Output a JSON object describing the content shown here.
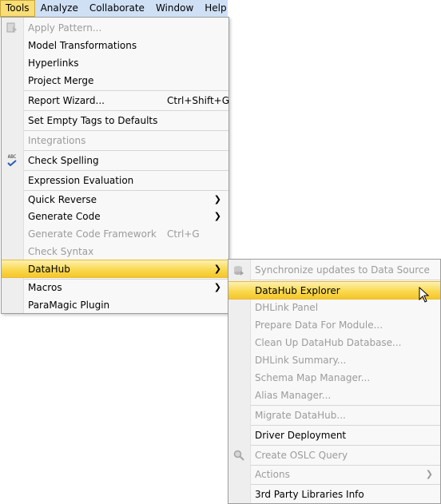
{
  "menubar": {
    "items": [
      "Tools",
      "Analyze",
      "Collaborate",
      "Window",
      "Help"
    ]
  },
  "tools_menu": {
    "items": [
      {
        "label": "Apply Pattern...",
        "enabled": false,
        "icon": "apply-pattern-icon"
      },
      {
        "label": "Model Transformations",
        "enabled": true
      },
      {
        "label": "Hyperlinks",
        "enabled": true
      },
      {
        "label": "Project Merge",
        "enabled": true
      },
      {
        "label": "Report Wizard...",
        "shortcut": "Ctrl+Shift+G",
        "enabled": true
      },
      {
        "label": "Set Empty Tags to Defaults",
        "enabled": true
      },
      {
        "label": "Integrations",
        "enabled": false
      },
      {
        "label": "Check Spelling",
        "enabled": true,
        "icon": "spell-check-icon",
        "icon_text": "ABC"
      },
      {
        "label": "Expression Evaluation",
        "enabled": true
      },
      {
        "label": "Quick Reverse",
        "enabled": true,
        "submenu": true
      },
      {
        "label": "Generate Code",
        "enabled": true,
        "submenu": true
      },
      {
        "label": "Generate Code Framework",
        "shortcut": "Ctrl+G",
        "enabled": false
      },
      {
        "label": "Check Syntax",
        "enabled": false
      },
      {
        "label": "DataHub",
        "enabled": true,
        "submenu": true,
        "highlighted": true
      },
      {
        "label": "Macros",
        "enabled": true,
        "submenu": true
      },
      {
        "label": "ParaMagic Plugin",
        "enabled": true
      }
    ]
  },
  "datahub_menu": {
    "items": [
      {
        "label": "Synchronize updates to Data Source",
        "enabled": false,
        "icon": "sync-icon"
      },
      {
        "label": "DataHub Explorer",
        "enabled": true,
        "highlighted": true
      },
      {
        "label": "DHLink Panel",
        "enabled": false
      },
      {
        "label": "Prepare Data For Module...",
        "enabled": false
      },
      {
        "label": "Clean Up DataHub Database...",
        "enabled": false
      },
      {
        "label": "DHLink Summary...",
        "enabled": false
      },
      {
        "label": "Schema Map Manager...",
        "enabled": false
      },
      {
        "label": "Alias Manager...",
        "enabled": false
      },
      {
        "label": "Migrate DataHub...",
        "enabled": false
      },
      {
        "label": "Driver Deployment",
        "enabled": true
      },
      {
        "label": "Create OSLC Query",
        "enabled": false,
        "icon": "search-icon"
      },
      {
        "label": "Actions",
        "enabled": false,
        "submenu": true
      },
      {
        "label": "3rd Party Libraries Info",
        "enabled": true
      }
    ]
  },
  "colors": {
    "highlight": "#f9d94f",
    "menubar_bg": "#cfe0f5",
    "disabled_text": "#9b9b9b"
  },
  "cursor": "pointer-arrow-icon"
}
